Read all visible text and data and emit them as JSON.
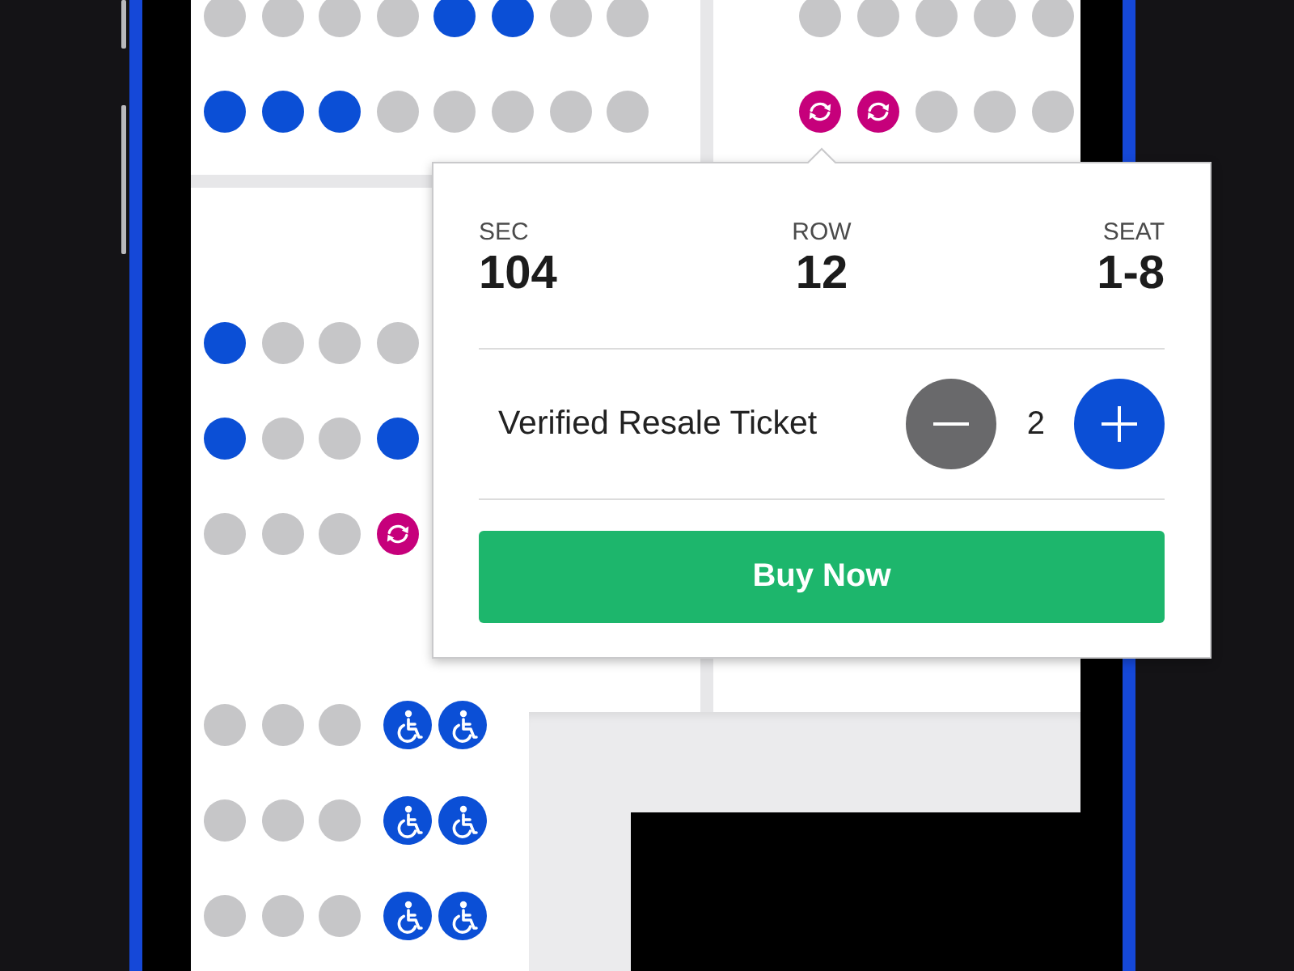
{
  "seat_map": {
    "sections": [
      {
        "rows": [
          {
            "seats": [
              {
                "kind": "unavailable"
              },
              {
                "kind": "unavailable"
              },
              {
                "kind": "unavailable"
              },
              {
                "kind": "unavailable"
              },
              {
                "kind": "available"
              },
              {
                "kind": "available"
              },
              {
                "kind": "unavailable"
              },
              {
                "kind": "unavailable"
              }
            ]
          },
          {
            "seats": [
              {
                "kind": "available"
              },
              {
                "kind": "available"
              },
              {
                "kind": "available"
              },
              {
                "kind": "unavailable"
              },
              {
                "kind": "unavailable"
              },
              {
                "kind": "unavailable"
              },
              {
                "kind": "unavailable"
              },
              {
                "kind": "unavailable"
              }
            ]
          }
        ]
      },
      {
        "rows": [
          {
            "seats": [
              {
                "kind": "unavailable"
              },
              {
                "kind": "unavailable"
              },
              {
                "kind": "unavailable"
              },
              {
                "kind": "unavailable"
              },
              {
                "kind": "unavailable"
              }
            ]
          },
          {
            "seats": [
              {
                "kind": "resale"
              },
              {
                "kind": "resale"
              },
              {
                "kind": "unavailable"
              },
              {
                "kind": "unavailable"
              },
              {
                "kind": "unavailable"
              }
            ]
          }
        ]
      },
      {
        "rows": [
          {
            "seats": [
              {
                "kind": "available"
              },
              {
                "kind": "unavailable"
              },
              {
                "kind": "unavailable"
              },
              {
                "kind": "unavailable"
              }
            ]
          },
          {
            "seats": [
              {
                "kind": "available"
              },
              {
                "kind": "unavailable"
              },
              {
                "kind": "unavailable"
              },
              {
                "kind": "available"
              }
            ]
          },
          {
            "seats": [
              {
                "kind": "unavailable"
              },
              {
                "kind": "unavailable"
              },
              {
                "kind": "unavailable"
              },
              {
                "kind": "resale"
              }
            ]
          }
        ]
      },
      {
        "rows": [
          {
            "seats": [
              {
                "kind": "unavailable"
              },
              {
                "kind": "unavailable"
              },
              {
                "kind": "unavailable"
              },
              {
                "kind": "accessible"
              },
              {
                "kind": "accessible"
              }
            ]
          },
          {
            "seats": [
              {
                "kind": "unavailable"
              },
              {
                "kind": "unavailable"
              },
              {
                "kind": "unavailable"
              },
              {
                "kind": "accessible"
              },
              {
                "kind": "accessible"
              }
            ]
          },
          {
            "seats": [
              {
                "kind": "unavailable"
              },
              {
                "kind": "unavailable"
              },
              {
                "kind": "unavailable"
              },
              {
                "kind": "accessible"
              },
              {
                "kind": "accessible"
              }
            ]
          }
        ]
      }
    ]
  },
  "ticket_popup": {
    "details": [
      {
        "label": "SEC",
        "value": "104"
      },
      {
        "label": "ROW",
        "value": "12"
      },
      {
        "label": "SEAT",
        "value": "1-8"
      }
    ],
    "ticket_type": "Verified Resale Ticket",
    "quantity": "2",
    "buy_button": "Buy Now"
  }
}
